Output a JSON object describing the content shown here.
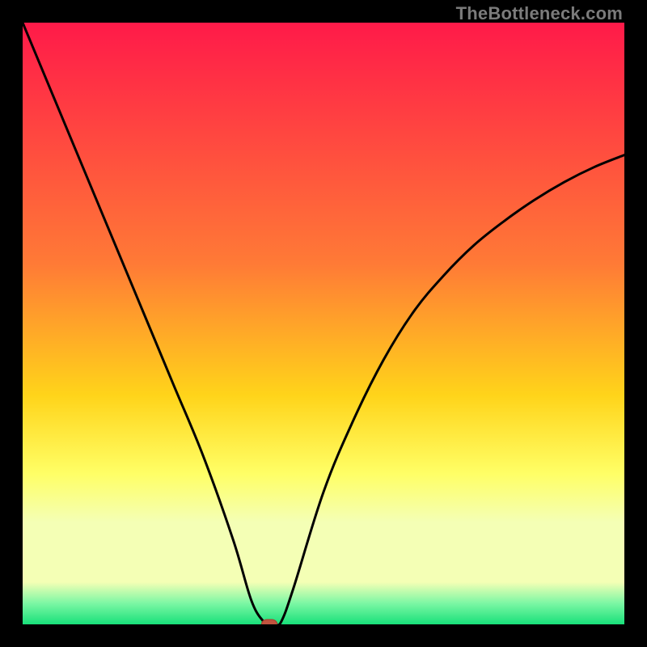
{
  "watermark": "TheBottleneck.com",
  "colors": {
    "background": "#000000",
    "grad_top": "#ff1a49",
    "grad_mid_upper": "#ff7a36",
    "grad_mid": "#ffd41a",
    "grad_lower": "#ffff66",
    "grad_pale": "#f4ffb5",
    "grad_green_light": "#7cf7a4",
    "grad_green": "#18e07a",
    "curve": "#000000",
    "marker_fill": "#c1543f",
    "marker_stroke": "#a8412f"
  },
  "chart_data": {
    "type": "line",
    "title": "",
    "xlabel": "",
    "ylabel": "",
    "xlim": [
      0,
      100
    ],
    "ylim": [
      0,
      100
    ],
    "series": [
      {
        "name": "bottleneck-curve",
        "x": [
          0,
          5,
          10,
          15,
          20,
          25,
          30,
          35,
          38,
          40,
          41,
          42,
          43,
          45,
          50,
          55,
          60,
          65,
          70,
          75,
          80,
          85,
          90,
          95,
          100
        ],
        "values": [
          100,
          88,
          76,
          64,
          52,
          40,
          28,
          14,
          4,
          0.5,
          0,
          0,
          0.5,
          6,
          22,
          34,
          44,
          52,
          58,
          63,
          67,
          70.5,
          73.5,
          76,
          78
        ]
      }
    ],
    "marker": {
      "x": 41,
      "y": 0
    },
    "gradient_stops_pct": [
      0,
      40,
      62,
      75,
      83,
      93,
      96.5,
      100
    ]
  }
}
